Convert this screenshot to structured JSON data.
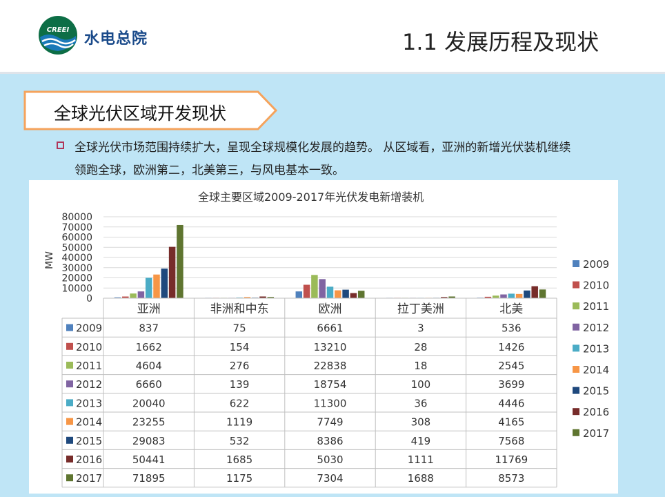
{
  "header": {
    "logo_text": "水电总院",
    "logo_badge": "CREEI",
    "page_title": "1.1 发展历程及现状"
  },
  "section": {
    "title": "全球光伏区域开发现状"
  },
  "bullet": {
    "line1": "全球光伏市场范围持续扩大，呈现全球规模化发展的趋势。 从区域看，亚洲的新增光伏装机继续",
    "line2": "领跑全球，欧洲第二，北美第三，与风电基本一致。"
  },
  "chart_data": {
    "type": "bar",
    "title": "全球主要区域2009-2017年光伏发电新增装机",
    "ylabel": "MW",
    "xlabel": "",
    "ylim": [
      0,
      80000
    ],
    "yticks": [
      0,
      10000,
      20000,
      30000,
      40000,
      50000,
      60000,
      70000,
      80000
    ],
    "grid": true,
    "legend_position": "right",
    "categories": [
      "亚洲",
      "非洲和中东",
      "欧洲",
      "拉丁美洲",
      "北美"
    ],
    "series": [
      {
        "name": "2009",
        "color": "#4f81bd",
        "values": [
          837,
          75,
          6661,
          3,
          536
        ]
      },
      {
        "name": "2010",
        "color": "#c0504d",
        "values": [
          1662,
          154,
          13210,
          28,
          1426
        ]
      },
      {
        "name": "2011",
        "color": "#9bbb59",
        "values": [
          4604,
          276,
          22838,
          18,
          2545
        ]
      },
      {
        "name": "2012",
        "color": "#8064a2",
        "values": [
          6660,
          139,
          18754,
          100,
          3699
        ]
      },
      {
        "name": "2013",
        "color": "#4bacc6",
        "values": [
          20040,
          622,
          11300,
          36,
          4446
        ]
      },
      {
        "name": "2014",
        "color": "#f79646",
        "values": [
          23255,
          1119,
          7749,
          308,
          4165
        ]
      },
      {
        "name": "2015",
        "color": "#1f497d",
        "values": [
          29083,
          532,
          8386,
          419,
          7568
        ]
      },
      {
        "name": "2016",
        "color": "#772c2a",
        "values": [
          50441,
          1685,
          5030,
          1111,
          11769
        ]
      },
      {
        "name": "2017",
        "color": "#5f7530",
        "values": [
          71895,
          1175,
          7304,
          1688,
          8573
        ]
      }
    ]
  }
}
